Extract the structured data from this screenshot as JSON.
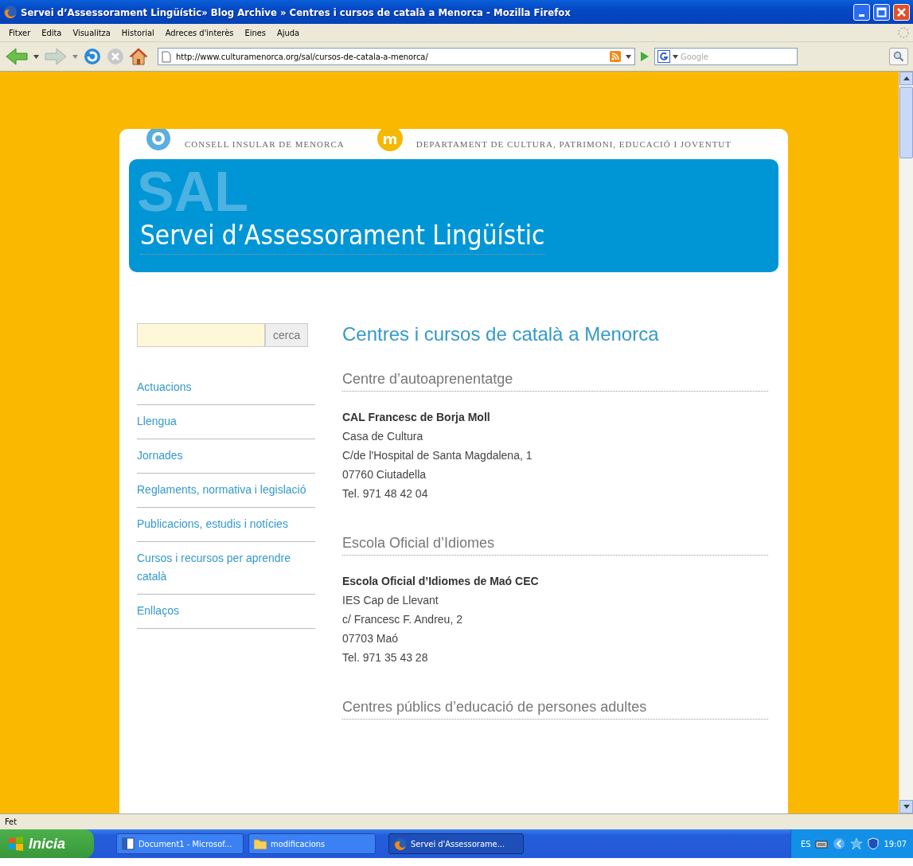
{
  "window": {
    "title": "Servei d’Assessorament Lingüístic» Blog Archive » Centres i cursos de català a Menorca - Mozilla Firefox"
  },
  "menu": [
    "Fitxer",
    "Edita",
    "Visualitza",
    "Historial",
    "Adreces d'interès",
    "Eines",
    "Ajuda"
  ],
  "toolbar": {
    "url": "http://www.culturamenorca.org/sal/cursos-de-catala-a-menorca/",
    "search_placeholder": "Google"
  },
  "site": {
    "org": "CONSELL INSULAR DE MENORCA",
    "dept": "DEPARTAMENT DE CULTURA, PATRIMONI, EDUCACIÓ I JOVENTUT",
    "banner_mark": "SAL",
    "banner_title": "Servei d’Assessorament Lingüístic",
    "search_button": "cerca",
    "nav": [
      "Actuacions",
      "Llengua",
      "Jornades",
      "Reglaments, normativa i legislació",
      "Publicacions, estudis i notícies",
      "Cursos i recursos per aprendre català",
      "Enllaços"
    ],
    "page_title": "Centres i cursos de català a Menorca",
    "sections": [
      {
        "heading": "Centre d’autoaprenentatge",
        "entries": [
          {
            "name": "CAL Francesc de Borja Moll",
            "lines": [
              "Casa de Cultura",
              "C/de l'Hospital de Santa Magdalena, 1",
              "07760 Ciutadella",
              "Tel. 971 48 42 04"
            ]
          }
        ]
      },
      {
        "heading": "Escola Oficial d’Idiomes",
        "entries": [
          {
            "name": "Escola Oficial d’Idiomes de Maó CEC",
            "lines": [
              "IES Cap de Llevant",
              "c/ Francesc F. Andreu, 2",
              "07703 Maó",
              "Tel. 971 35 43 28"
            ]
          }
        ]
      },
      {
        "heading": "Centres públics d’educació de persones adultes"
      }
    ]
  },
  "status_bar": "Fet",
  "taskbar": {
    "start": "Inicia",
    "tasks": [
      {
        "label": "Document1 - Microsof...",
        "kind": "document",
        "selected": false
      },
      {
        "label": "modificacions",
        "kind": "folder",
        "selected": false
      },
      {
        "label": "Servei d'Assessorame...",
        "kind": "browser",
        "selected": true
      }
    ],
    "language": "ES",
    "clock": "19:07"
  }
}
